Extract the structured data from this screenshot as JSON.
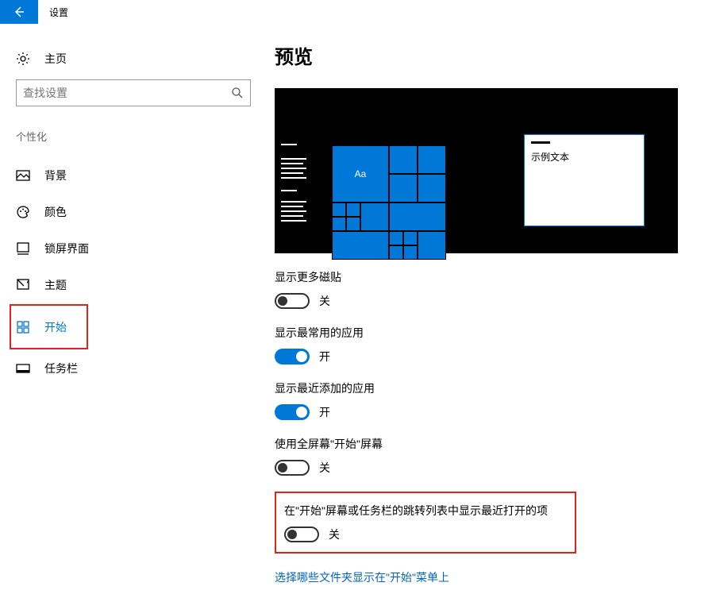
{
  "app": {
    "title": "设置"
  },
  "sidebar": {
    "home": "主页",
    "search_placeholder": "查找设置",
    "category": "个性化",
    "items": [
      {
        "label": "背景"
      },
      {
        "label": "颜色"
      },
      {
        "label": "锁屏界面"
      },
      {
        "label": "主题"
      },
      {
        "label": "开始"
      },
      {
        "label": "任务栏"
      }
    ]
  },
  "main": {
    "title": "预览",
    "preview": {
      "tile_text": "Aa",
      "sample_text": "示例文本"
    },
    "settings": [
      {
        "label": "显示更多磁贴",
        "on": false
      },
      {
        "label": "显示最常用的应用",
        "on": true
      },
      {
        "label": "显示最近添加的应用",
        "on": true
      },
      {
        "label": "使用全屏幕\"开始\"屏幕",
        "on": false
      },
      {
        "label": "在\"开始\"屏幕或任务栏的跳转列表中显示最近打开的项",
        "on": false
      }
    ],
    "state_on": "开",
    "state_off": "关",
    "link": "选择哪些文件夹显示在\"开始\"菜单上"
  }
}
